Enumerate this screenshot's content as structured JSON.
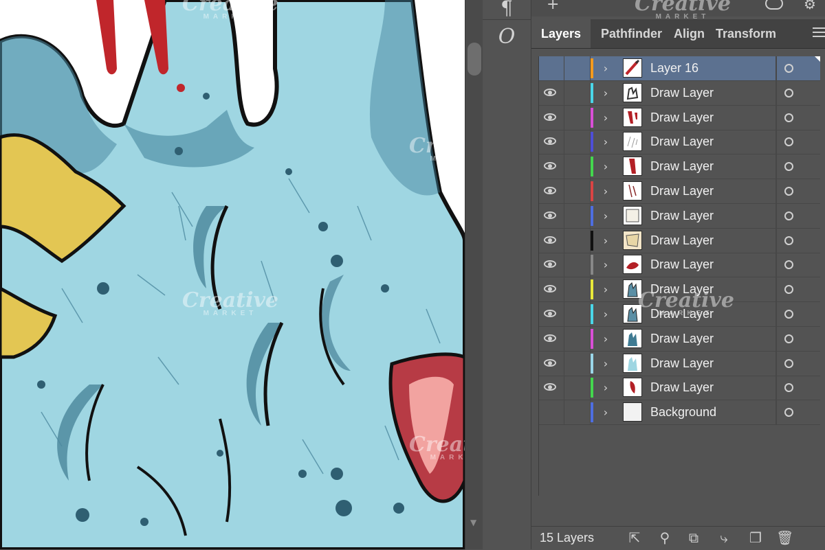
{
  "toolbar": {
    "paragraph_glyph": "¶",
    "opentype_glyph": "O"
  },
  "panel": {
    "tabs": [
      {
        "label": "Layers",
        "active": true
      },
      {
        "label": "Pathfinder",
        "active": false
      },
      {
        "label": "Align",
        "active": false
      },
      {
        "label": "Transform",
        "active": false
      }
    ],
    "layers": [
      {
        "name": "Layer 16",
        "color": "#f39a1e",
        "visible": false,
        "selected": true,
        "thumb": "brush"
      },
      {
        "name": "Draw Layer",
        "color": "#4ad6e8",
        "visible": true,
        "selected": false,
        "thumb": "hand-sketch"
      },
      {
        "name": "Draw Layer",
        "color": "#d94fd6",
        "visible": true,
        "selected": false,
        "thumb": "blood"
      },
      {
        "name": "Draw Layer",
        "color": "#4e4ed6",
        "visible": true,
        "selected": false,
        "thumb": "scratch"
      },
      {
        "name": "Draw Layer",
        "color": "#44d64e",
        "visible": true,
        "selected": false,
        "thumb": "blood-drip"
      },
      {
        "name": "Draw Layer",
        "color": "#d94444",
        "visible": true,
        "selected": false,
        "thumb": "lines"
      },
      {
        "name": "Draw Layer",
        "color": "#4e6ee0",
        "visible": true,
        "selected": false,
        "thumb": "paper"
      },
      {
        "name": "Draw Layer",
        "color": "#111111",
        "visible": true,
        "selected": false,
        "thumb": "nail"
      },
      {
        "name": "Draw Layer",
        "color": "#888888",
        "visible": true,
        "selected": false,
        "thumb": "wound"
      },
      {
        "name": "Draw Layer",
        "color": "#e8e83a",
        "visible": true,
        "selected": false,
        "thumb": "hand-blue"
      },
      {
        "name": "Draw Layer",
        "color": "#4ad6e8",
        "visible": true,
        "selected": false,
        "thumb": "hand-blue"
      },
      {
        "name": "Draw Layer",
        "color": "#d94fd6",
        "visible": true,
        "selected": false,
        "thumb": "hand-fill"
      },
      {
        "name": "Draw Layer",
        "color": "#9ad6e8",
        "visible": true,
        "selected": false,
        "thumb": "hand-light"
      },
      {
        "name": "Draw Layer",
        "color": "#44d64e",
        "visible": true,
        "selected": false,
        "thumb": "wound-red"
      },
      {
        "name": "Background",
        "color": "#4e6ee0",
        "visible": false,
        "selected": false,
        "thumb": "blank"
      }
    ],
    "footer": {
      "layer_count": "15 Layers",
      "icons": [
        "export-icon",
        "search-icon",
        "clipping-mask-icon",
        "new-sublayer-icon",
        "new-layer-icon",
        "trash-icon"
      ]
    }
  },
  "watermark": {
    "text": "Creative",
    "sub": "MARKET"
  }
}
